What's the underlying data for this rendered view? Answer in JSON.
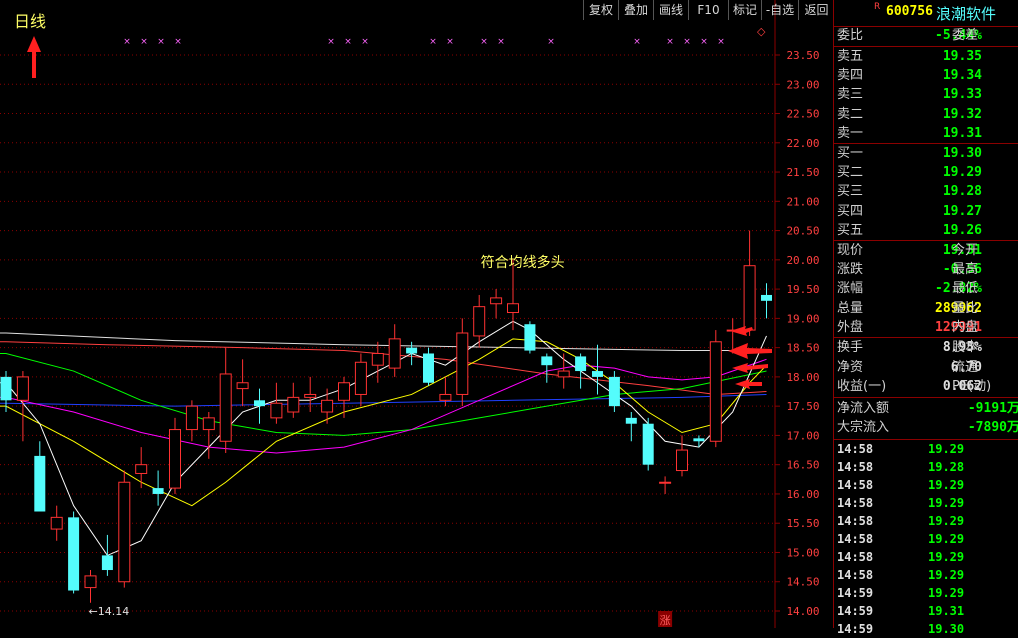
{
  "header": {
    "period_label": "日线",
    "toolbar": [
      "复权",
      "叠加",
      "画线",
      "F10",
      "标记",
      "-自选",
      "返回"
    ],
    "small_marker": "◇",
    "r_marker": "R",
    "stock_code": "600756",
    "stock_name": "浪潮软件"
  },
  "colors": {
    "up": "#ff3232",
    "down": "#54fcfc",
    "grid": "#8b0000",
    "ma5": "#ffffff",
    "ma10": "#ffff00",
    "ma20": "#ff00ff",
    "ma30": "#00ff00",
    "ma60": "#ff4040",
    "ma120": "#e0e0e0",
    "ma250": "#2040ff",
    "green_val": "#00ff00",
    "red_val": "#ff4040",
    "yellow_val": "#ffff00"
  },
  "chart_data": {
    "type": "candlestick",
    "ylim": [
      14.0,
      23.5
    ],
    "y_ticks": [
      "23.50",
      "23.00",
      "22.50",
      "22.00",
      "21.50",
      "21.00",
      "20.50",
      "20.00",
      "19.50",
      "19.00",
      "18.50",
      "18.00",
      "17.50",
      "17.00",
      "16.50",
      "16.00",
      "15.50",
      "15.00",
      "14.50",
      "14.00"
    ],
    "candles": [
      {
        "o": 18.0,
        "c": 17.6,
        "h": 18.1,
        "l": 17.4
      },
      {
        "o": 17.6,
        "c": 18.0,
        "h": 18.1,
        "l": 16.9
      },
      {
        "o": 16.65,
        "c": 15.7,
        "h": 16.9,
        "l": 15.7
      },
      {
        "o": 15.4,
        "c": 15.6,
        "h": 15.8,
        "l": 15.2
      },
      {
        "o": 15.6,
        "c": 14.35,
        "h": 15.7,
        "l": 14.3
      },
      {
        "o": 14.4,
        "c": 14.6,
        "h": 14.7,
        "l": 14.14
      },
      {
        "o": 14.95,
        "c": 14.7,
        "h": 15.3,
        "l": 14.6
      },
      {
        "o": 14.5,
        "c": 16.2,
        "h": 16.4,
        "l": 14.4
      },
      {
        "o": 16.35,
        "c": 16.5,
        "h": 16.8,
        "l": 16.1
      },
      {
        "o": 16.1,
        "c": 16.0,
        "h": 16.4,
        "l": 15.8
      },
      {
        "o": 16.1,
        "c": 17.1,
        "h": 17.3,
        "l": 16.0
      },
      {
        "o": 17.1,
        "c": 17.5,
        "h": 17.6,
        "l": 16.9
      },
      {
        "o": 17.1,
        "c": 17.3,
        "h": 17.4,
        "l": 16.6
      },
      {
        "o": 16.9,
        "c": 18.05,
        "h": 18.5,
        "l": 16.7
      },
      {
        "o": 17.8,
        "c": 17.9,
        "h": 18.3,
        "l": 17.5
      },
      {
        "o": 17.6,
        "c": 17.5,
        "h": 17.8,
        "l": 17.2
      },
      {
        "o": 17.3,
        "c": 17.55,
        "h": 17.9,
        "l": 17.2
      },
      {
        "o": 17.4,
        "c": 17.65,
        "h": 17.9,
        "l": 17.3
      },
      {
        "o": 17.65,
        "c": 17.7,
        "h": 18.0,
        "l": 17.4
      },
      {
        "o": 17.4,
        "c": 17.6,
        "h": 17.8,
        "l": 17.2
      },
      {
        "o": 17.6,
        "c": 17.9,
        "h": 18.0,
        "l": 17.3
      },
      {
        "o": 17.7,
        "c": 18.25,
        "h": 18.4,
        "l": 17.5
      },
      {
        "o": 18.2,
        "c": 18.4,
        "h": 18.6,
        "l": 17.9
      },
      {
        "o": 18.15,
        "c": 18.65,
        "h": 18.9,
        "l": 18.0
      },
      {
        "o": 18.5,
        "c": 18.4,
        "h": 18.6,
        "l": 18.2
      },
      {
        "o": 18.4,
        "c": 17.9,
        "h": 18.5,
        "l": 17.85
      },
      {
        "o": 17.6,
        "c": 17.7,
        "h": 18.0,
        "l": 17.5
      },
      {
        "o": 17.7,
        "c": 18.75,
        "h": 19.0,
        "l": 17.5
      },
      {
        "o": 18.7,
        "c": 19.2,
        "h": 19.4,
        "l": 18.5
      },
      {
        "o": 19.25,
        "c": 19.35,
        "h": 19.5,
        "l": 19.0
      },
      {
        "o": 19.1,
        "c": 19.25,
        "h": 20.0,
        "l": 18.8
      },
      {
        "o": 18.9,
        "c": 18.45,
        "h": 18.95,
        "l": 18.4
      },
      {
        "o": 18.35,
        "c": 18.2,
        "h": 18.4,
        "l": 17.9
      },
      {
        "o": 18.0,
        "c": 18.1,
        "h": 18.4,
        "l": 17.8
      },
      {
        "o": 18.35,
        "c": 18.1,
        "h": 18.4,
        "l": 17.8
      },
      {
        "o": 18.1,
        "c": 18.0,
        "h": 18.55,
        "l": 17.7
      },
      {
        "o": 18.0,
        "c": 17.5,
        "h": 18.1,
        "l": 17.4
      },
      {
        "o": 17.3,
        "c": 17.2,
        "h": 17.4,
        "l": 16.9
      },
      {
        "o": 17.2,
        "c": 16.5,
        "h": 17.3,
        "l": 16.4
      },
      {
        "o": 16.2,
        "c": 16.2,
        "h": 16.3,
        "l": 16.0
      },
      {
        "o": 16.4,
        "c": 16.75,
        "h": 17.0,
        "l": 16.3
      },
      {
        "o": 16.95,
        "c": 16.9,
        "h": 17.0,
        "l": 16.8
      },
      {
        "o": 16.9,
        "c": 18.6,
        "h": 18.8,
        "l": 16.8
      },
      {
        "o": 18.8,
        "c": 18.8,
        "h": 19.0,
        "l": 18.4
      },
      {
        "o": 18.8,
        "c": 19.9,
        "h": 20.5,
        "l": 18.7
      },
      {
        "o": 19.4,
        "c": 19.3,
        "h": 19.6,
        "l": 19.0
      }
    ],
    "ma_lines": [
      {
        "key": "ma250",
        "points": [
          [
            0,
            17.55
          ],
          [
            10,
            17.5
          ],
          [
            20,
            17.55
          ],
          [
            30,
            17.6
          ],
          [
            40,
            17.65
          ],
          [
            45,
            17.7
          ]
        ]
      },
      {
        "key": "ma120",
        "points": [
          [
            0,
            18.75
          ],
          [
            10,
            18.62
          ],
          [
            20,
            18.55
          ],
          [
            30,
            18.5
          ],
          [
            40,
            18.45
          ],
          [
            45,
            18.45
          ]
        ]
      },
      {
        "key": "ma60",
        "points": [
          [
            0,
            18.6
          ],
          [
            6,
            18.55
          ],
          [
            14,
            18.5
          ],
          [
            20,
            18.45
          ],
          [
            26,
            18.3
          ],
          [
            32,
            18.05
          ],
          [
            38,
            17.85
          ],
          [
            42,
            17.7
          ],
          [
            45,
            17.75
          ]
        ]
      },
      {
        "key": "ma30",
        "points": [
          [
            0,
            18.4
          ],
          [
            4,
            18.1
          ],
          [
            8,
            17.6
          ],
          [
            12,
            17.25
          ],
          [
            16,
            17.05
          ],
          [
            20,
            17.0
          ],
          [
            24,
            17.1
          ],
          [
            28,
            17.3
          ],
          [
            32,
            17.5
          ],
          [
            36,
            17.7
          ],
          [
            40,
            17.8
          ],
          [
            45,
            18.1
          ]
        ]
      },
      {
        "key": "ma20",
        "points": [
          [
            0,
            17.65
          ],
          [
            4,
            17.4
          ],
          [
            8,
            17.05
          ],
          [
            12,
            16.8
          ],
          [
            16,
            16.7
          ],
          [
            20,
            16.8
          ],
          [
            24,
            17.1
          ],
          [
            28,
            17.6
          ],
          [
            32,
            18.1
          ],
          [
            34,
            18.2
          ],
          [
            36,
            18.15
          ],
          [
            38,
            18.0
          ],
          [
            40,
            17.95
          ],
          [
            42,
            18.0
          ],
          [
            45,
            18.3
          ]
        ]
      },
      {
        "key": "ma10",
        "points": [
          [
            0,
            17.5
          ],
          [
            4,
            16.9
          ],
          [
            8,
            16.2
          ],
          [
            11,
            15.8
          ],
          [
            13,
            16.2
          ],
          [
            16,
            16.9
          ],
          [
            20,
            17.4
          ],
          [
            24,
            17.7
          ],
          [
            28,
            18.3
          ],
          [
            30,
            18.65
          ],
          [
            32,
            18.6
          ],
          [
            34,
            18.3
          ],
          [
            36,
            17.9
          ],
          [
            38,
            17.4
          ],
          [
            40,
            17.05
          ],
          [
            42,
            17.2
          ],
          [
            44,
            17.9
          ],
          [
            45,
            18.2
          ]
        ]
      },
      {
        "key": "ma5",
        "points": [
          [
            0,
            17.9
          ],
          [
            2,
            17.2
          ],
          [
            4,
            15.8
          ],
          [
            6,
            14.95
          ],
          [
            8,
            15.2
          ],
          [
            10,
            16.2
          ],
          [
            12,
            16.8
          ],
          [
            14,
            17.4
          ],
          [
            16,
            17.6
          ],
          [
            18,
            17.6
          ],
          [
            20,
            17.8
          ],
          [
            22,
            18.1
          ],
          [
            24,
            18.4
          ],
          [
            26,
            18.2
          ],
          [
            28,
            18.6
          ],
          [
            30,
            18.95
          ],
          [
            31,
            18.8
          ],
          [
            33,
            18.3
          ],
          [
            35,
            17.9
          ],
          [
            37,
            17.5
          ],
          [
            39,
            16.9
          ],
          [
            41,
            16.8
          ],
          [
            43,
            17.4
          ],
          [
            45,
            18.7
          ]
        ]
      }
    ],
    "annotations": [
      {
        "type": "text",
        "text": "符合均线多头",
        "x": 28.5,
        "y": 19.95
      },
      {
        "type": "min_label",
        "text": "←14.14",
        "x": 5,
        "y": 14.14
      },
      {
        "type": "up_marker",
        "text": "涨",
        "x": 39
      }
    ]
  },
  "panel": {
    "weibi": {
      "label": "委比",
      "value": "-5.44%",
      "label2": "委差"
    },
    "asks": [
      {
        "label": "卖五",
        "price": "19.35"
      },
      {
        "label": "卖四",
        "price": "19.34"
      },
      {
        "label": "卖三",
        "price": "19.33"
      },
      {
        "label": "卖二",
        "price": "19.32"
      },
      {
        "label": "卖一",
        "price": "19.31"
      }
    ],
    "bids": [
      {
        "label": "买一",
        "price": "19.30"
      },
      {
        "label": "买二",
        "price": "19.29"
      },
      {
        "label": "买三",
        "price": "19.28"
      },
      {
        "label": "买四",
        "price": "19.27"
      },
      {
        "label": "买五",
        "price": "19.26"
      }
    ],
    "stats": [
      {
        "label": "现价",
        "value": "19.31",
        "label2": "今开",
        "color": "green"
      },
      {
        "label": "涨跌",
        "value": "-0.56",
        "label2": "最高",
        "color": "green"
      },
      {
        "label": "涨幅",
        "value": "-2.82%",
        "label2": "最低",
        "color": "green"
      },
      {
        "label": "总量",
        "value": "289962",
        "label2": "量比",
        "color": "yellow"
      },
      {
        "label": "外盘",
        "value": "129991",
        "label2": "内盘",
        "color": "red"
      }
    ],
    "stats2": [
      {
        "label": "换手",
        "value": "8.95%",
        "label2": "股本"
      },
      {
        "label": "净资",
        "value": "6.70",
        "label2": "流通"
      },
      {
        "label": "收益(一)",
        "value": "0.062",
        "label2": "PE(动)"
      }
    ],
    "flows": [
      {
        "label": "净流入额",
        "value": "-9191万"
      },
      {
        "label": "大宗流入",
        "value": "-7890万"
      }
    ],
    "ticks": [
      {
        "time": "14:58",
        "price": "19.29"
      },
      {
        "time": "14:58",
        "price": "19.28"
      },
      {
        "time": "14:58",
        "price": "19.29"
      },
      {
        "time": "14:58",
        "price": "19.29"
      },
      {
        "time": "14:58",
        "price": "19.29"
      },
      {
        "time": "14:58",
        "price": "19.29"
      },
      {
        "time": "14:58",
        "price": "19.29"
      },
      {
        "time": "14:58",
        "price": "19.29"
      },
      {
        "time": "14:59",
        "price": "19.29"
      },
      {
        "time": "14:59",
        "price": "19.31"
      },
      {
        "time": "14:59",
        "price": "19.30"
      }
    ]
  }
}
